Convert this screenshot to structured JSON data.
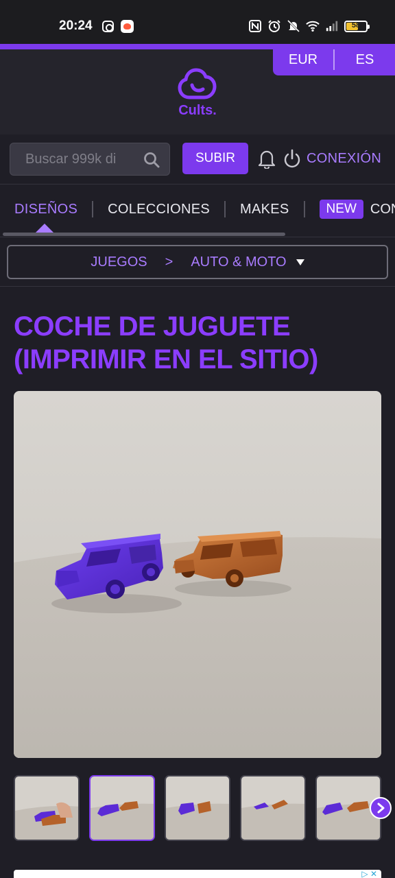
{
  "status_bar": {
    "time": "20:24",
    "battery_level": "58",
    "icons": [
      "instagram-icon",
      "app-icon",
      "nfc-icon",
      "alarm-icon",
      "mute-icon",
      "wifi-icon",
      "signal-icon",
      "battery-icon"
    ]
  },
  "currency": {
    "eur": "EUR",
    "lang": "ES"
  },
  "header": {
    "logo_text": "Cults."
  },
  "search": {
    "placeholder": "Buscar 999k di"
  },
  "actions": {
    "upload_label": "SUBIR",
    "login_label": "CONEXIÓN"
  },
  "nav": {
    "items": [
      {
        "label": "DISEÑOS",
        "active": true
      },
      {
        "label": "COLECCIONES"
      },
      {
        "label": "MAKES"
      }
    ],
    "new_badge": "NEW",
    "cut_item": "CON"
  },
  "breadcrumb": {
    "category": "JUEGOS",
    "separator": ">",
    "subcategory": "AUTO & MOTO"
  },
  "product": {
    "title": "COCHE DE JUGUETE (IMPRIMIR EN EL SITIO)"
  },
  "colors": {
    "accent": "#7c3aed",
    "accent_text": "#a97cff",
    "background": "#1f1e26",
    "car_purple": "#5b2bd6",
    "car_copper": "#b5622a"
  },
  "thumbnails": {
    "count": 5,
    "selected_index": 1
  }
}
